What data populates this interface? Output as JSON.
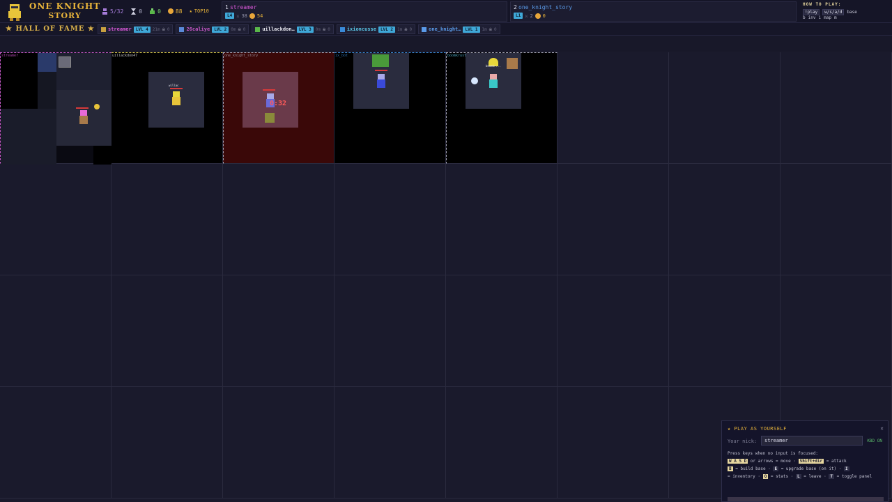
{
  "logo": {
    "line1": "ONE KNIGHT",
    "line2": "STORY"
  },
  "stats": {
    "online": "5/32",
    "timer": "0",
    "kills": "0",
    "coins": "88",
    "top": "TOP10"
  },
  "leaderboard": [
    {
      "rank": "1",
      "name": "streamer",
      "name_color": "#d858d8",
      "level": "L4",
      "kills": "38",
      "coins": "54"
    },
    {
      "rank": "2",
      "name": "one_knight_story",
      "name_color": "#5a9ae8",
      "level": "L1",
      "kills": "2",
      "coins": "0"
    }
  ],
  "howto": {
    "title": "HOW TO PLAY:",
    "k1": "!play",
    "k2": "w/s/a/d",
    "k3": "base",
    "k4": "b",
    "k5": "inv",
    "k6": "i",
    "k7": "map",
    "k8": "m"
  },
  "hall_of_fame": {
    "title": "★ HALL OF FAME ★",
    "entries": [
      {
        "name": "streamer",
        "color": "#d858d8",
        "level": "LVL 4",
        "time": "21m",
        "skulls": "0"
      },
      {
        "name": "26caliye",
        "color": "#c858c8",
        "level": "LVL 2",
        "time": "0m",
        "skulls": "0"
      },
      {
        "name": "uillackdon…",
        "color": "#e8e8f0",
        "level": "LVL 3",
        "time": "0m",
        "skulls": "0"
      },
      {
        "name": "ixioncusse",
        "color": "#5ac8e8",
        "level": "LVL 2",
        "time": "1m",
        "skulls": "0"
      },
      {
        "name": "one_knight…",
        "color": "#5a9ae8",
        "level": "LVL 1",
        "time": "1m",
        "skulls": "0"
      }
    ]
  },
  "cells": [
    {
      "label": "streamer"
    },
    {
      "label": "uillackdon47"
    },
    {
      "label": "one_knight_story"
    },
    {
      "label": "ix_bot"
    },
    {
      "label": "boomkrust",
      "player_tag": "boomkr..."
    }
  ],
  "cell_text": {
    "willac": "willac",
    "timer": "0:32"
  },
  "panel": {
    "title": "★ PLAY AS YOURSELF",
    "close": "×",
    "nick_label": "Your nick:",
    "nick_value": "streamer",
    "kbd": "KBD ON",
    "help_intro": "Press keys when no input is focused:",
    "wasd": "W A S D",
    "or_arrows": "or arrows = move ·",
    "shift": "Shift+dir",
    "attack": "= attack",
    "b": "B",
    "build": "= build base ·",
    "e": "E",
    "upgrade": "= upgrade base (on it) ·",
    "i": "I",
    "inventory": "= inventory ·",
    "q": "Q",
    "stats": "= stats ·",
    "l": "L",
    "leave": "= leave ·",
    "t": "T",
    "toggle": "= toggle panel"
  }
}
